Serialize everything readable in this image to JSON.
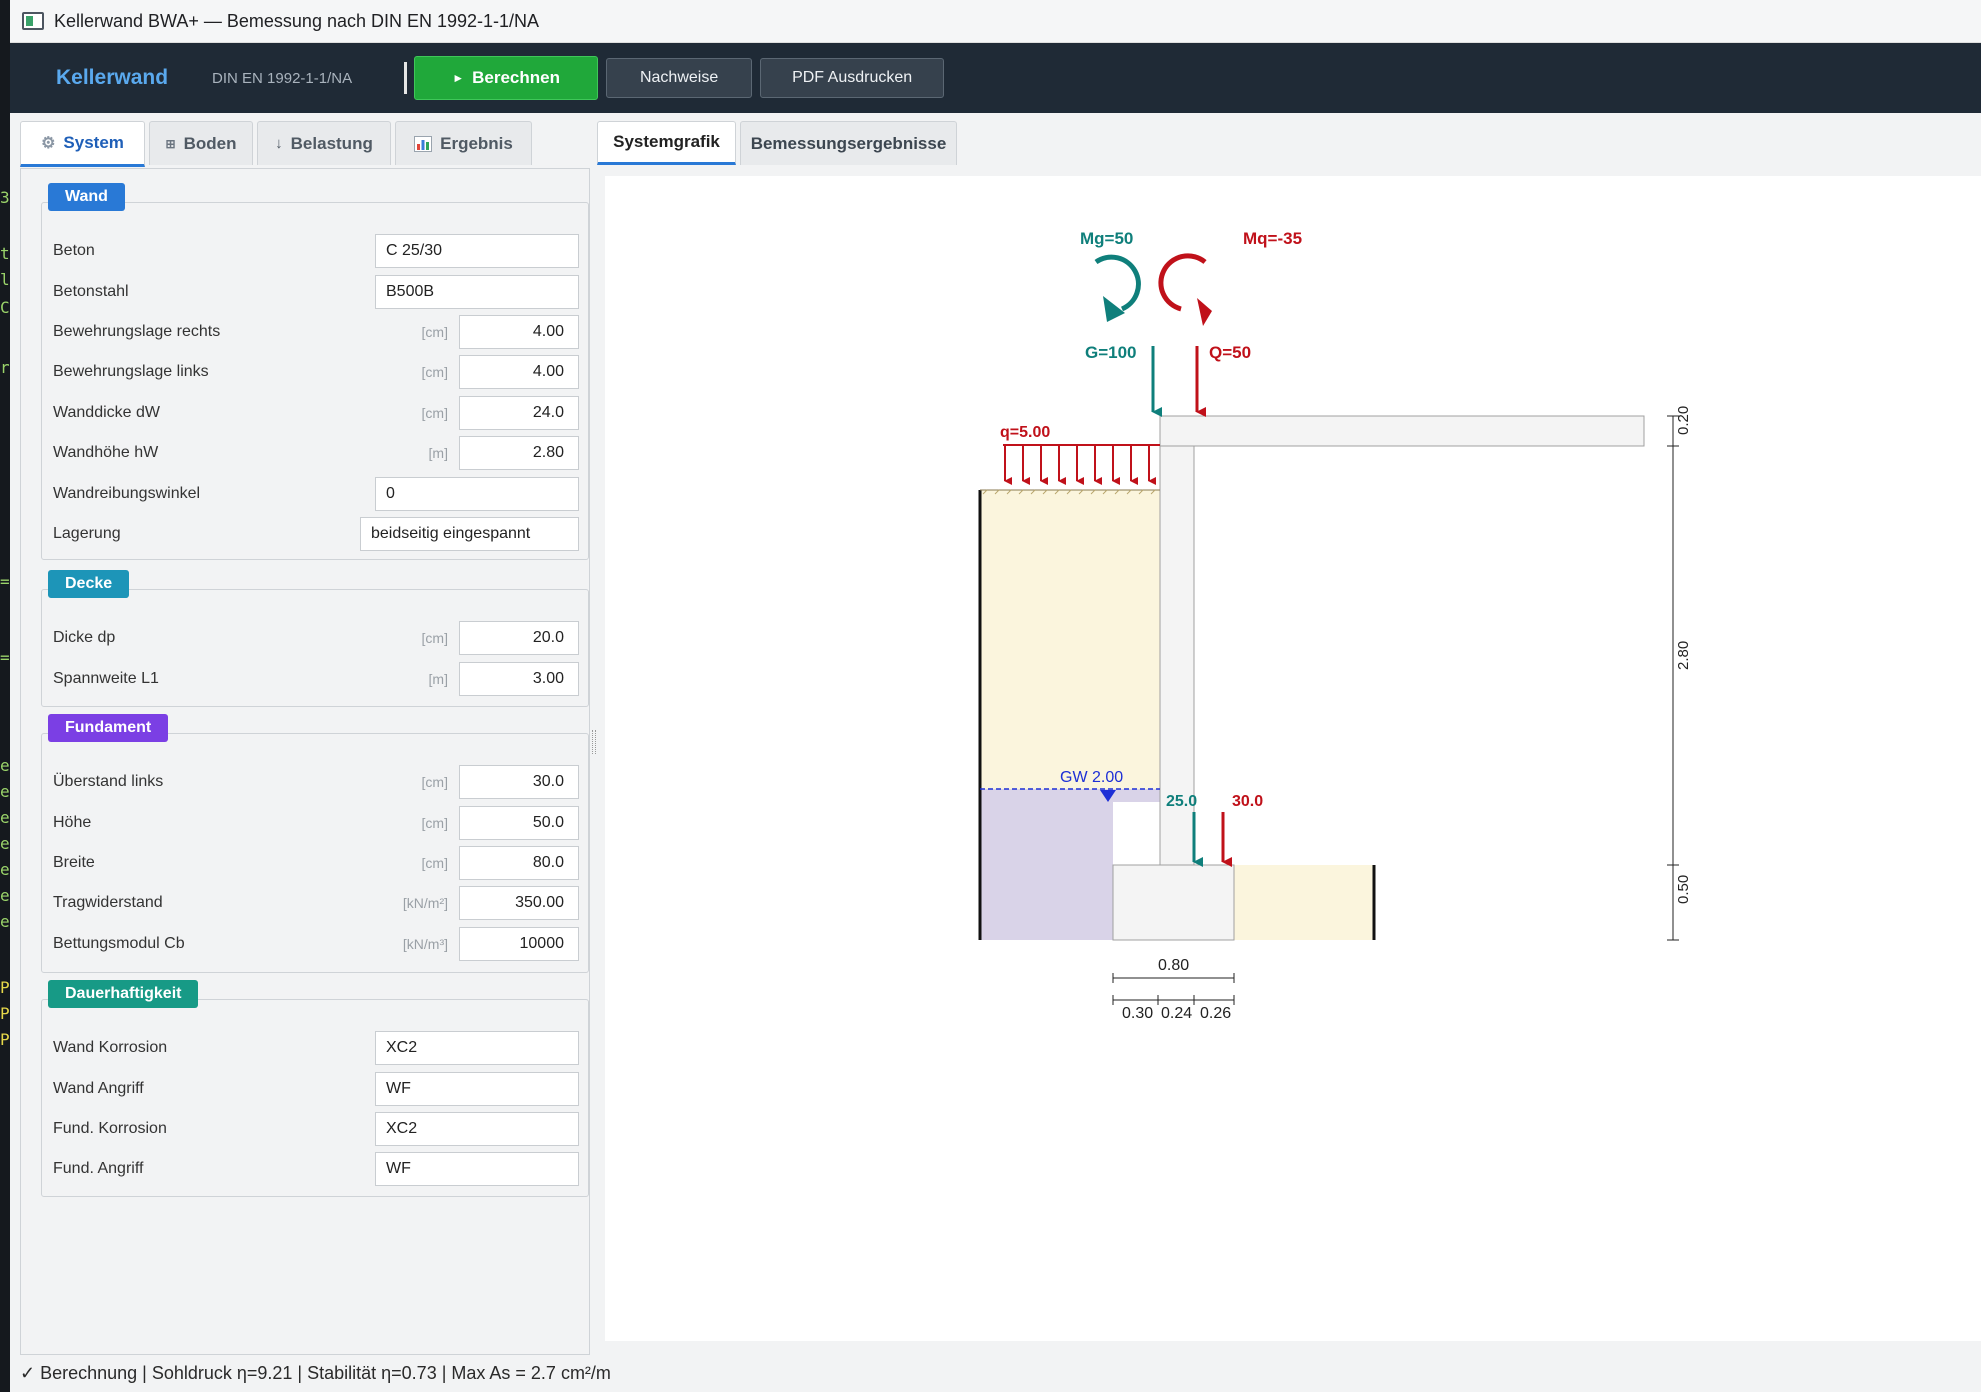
{
  "window": {
    "title": "Kellerwand BWA+  —  Bemessung nach DIN EN 1992-1-1/NA"
  },
  "toolbar": {
    "brand": "Kellerwand",
    "norm": "DIN EN 1992-1-1/NA",
    "run_label": "Berechnen",
    "checks_label": "Nachweise",
    "pdf_label": "PDF Ausdrucken"
  },
  "left_tabs": [
    {
      "label": "System",
      "icon": "gear-icon"
    },
    {
      "label": "Boden",
      "icon": "grid-icon"
    },
    {
      "label": "Belastung",
      "icon": "arrow-down-icon"
    },
    {
      "label": "Ergebnis",
      "icon": "chart-icon"
    }
  ],
  "groups": {
    "wand": {
      "title": "Wand",
      "color": "#2979d6",
      "rows": [
        {
          "label": "Beton",
          "unit": "",
          "value": "C 25/30"
        },
        {
          "label": "Betonstahl",
          "unit": "",
          "value": "B500B"
        },
        {
          "label": "Bewehrungslage rechts",
          "unit": "[cm]",
          "value": "4.00"
        },
        {
          "label": "Bewehrungslage links",
          "unit": "[cm]",
          "value": "4.00"
        },
        {
          "label": "Wanddicke  dW",
          "unit": "[cm]",
          "value": "24.0"
        },
        {
          "label": "Wandhöhe  hW",
          "unit": "[m]",
          "value": "2.80"
        },
        {
          "label": "Wandreibungswinkel",
          "unit": "",
          "value": "0"
        },
        {
          "label": "Lagerung",
          "unit": "",
          "value": "beidseitig eingespannt"
        }
      ]
    },
    "decke": {
      "title": "Decke",
      "color": "#1d95b8",
      "rows": [
        {
          "label": "Dicke  dp",
          "unit": "[cm]",
          "value": "20.0"
        },
        {
          "label": "Spannweite  L1",
          "unit": "[m]",
          "value": "3.00"
        }
      ]
    },
    "fundament": {
      "title": "Fundament",
      "color": "#7b3fe4",
      "rows": [
        {
          "label": "Überstand links",
          "unit": "[cm]",
          "value": "30.0"
        },
        {
          "label": "Höhe",
          "unit": "[cm]",
          "value": "50.0"
        },
        {
          "label": "Breite",
          "unit": "[cm]",
          "value": "80.0"
        },
        {
          "label": "Tragwiderstand",
          "unit": "[kN/m²]",
          "value": "350.00"
        },
        {
          "label": "Bettungsmodul  Cb",
          "unit": "[kN/m³]",
          "value": "10000"
        }
      ]
    },
    "dauer": {
      "title": "Dauerhaftigkeit",
      "color": "#179a86",
      "rows": [
        {
          "label": "Wand Korrosion",
          "unit": "",
          "value": "XC2"
        },
        {
          "label": "Wand Angriff",
          "unit": "",
          "value": "WF"
        },
        {
          "label": "Fund. Korrosion",
          "unit": "",
          "value": "XC2"
        },
        {
          "label": "Fund. Angriff",
          "unit": "",
          "value": "WF"
        }
      ]
    }
  },
  "right_tabs": [
    {
      "label": "Systemgrafik"
    },
    {
      "label": "Bemessungsergebnisse"
    }
  ],
  "drawing": {
    "mg_label": "Mg=50",
    "mq_label": "Mq=-35",
    "g_label": "G=100",
    "q_label": "Q=50",
    "q_line_label": "q=5.00",
    "gw_label": "GW 2.00",
    "f_g_label": "25.0",
    "f_q_label": "30.0",
    "dim_slab": "0.20",
    "dim_wall": "2.80",
    "dim_found": "0.50",
    "dim_width": "0.80",
    "dim_parts": [
      "0.30",
      "0.24",
      "0.26"
    ],
    "colors": {
      "permanent": "#0f7f7b",
      "variable": "#c0111a",
      "soil": "#fbf5dd",
      "water": "#d9d3e8",
      "concrete": "#f4f4f4"
    }
  },
  "status": {
    "text": "✓ Berechnung  |  Sohldruck η=9.21  |  Stabilität η=0.73  |  Max As = 2.7 cm²/m"
  }
}
